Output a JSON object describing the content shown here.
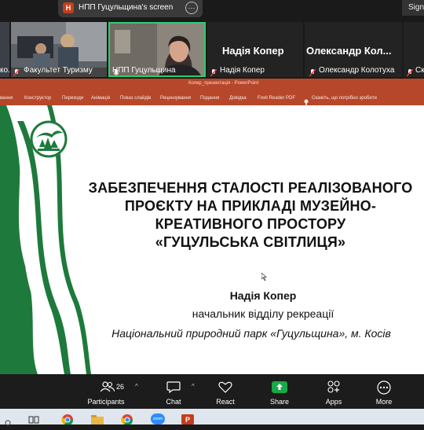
{
  "share_bar": {
    "app_letter": "H",
    "title": "НПП Гуцульщина's screen",
    "sign_label": "Sign"
  },
  "participants": [
    {
      "name": "Факультет Туризму",
      "prefix": "ко..."
    },
    {
      "name": "НПП Гуцульщина"
    },
    {
      "name": "Надія Копер",
      "display": "Надія Копер"
    },
    {
      "name": "Олександр Колотуха",
      "display": "Олександр Кол..."
    },
    {
      "name": "Ск"
    }
  ],
  "powerpoint": {
    "title": "Копер_презентація  -  PowerPoint",
    "ribbon": [
      "вання",
      "Конструктор",
      "Переходи",
      "Анімація",
      "Показ слайдів",
      "Рецензування",
      "Подання",
      "Довідка",
      "Foxit Reader PDF",
      "Скажіть, що потрібно зробити"
    ]
  },
  "slide": {
    "title_lines": [
      "ЗАБЕЗПЕЧЕННЯ СТАЛОСТІ РЕАЛІЗОВАНОГО",
      "ПРОЄКТУ НА ПРИКЛАДІ МУЗЕЙНО-",
      "КРЕАТИВНОГО ПРОСТОРУ",
      "«ГУЦУЛЬСЬКА СВІТЛИЦЯ»"
    ],
    "author": "Надія Копер",
    "position": "начальник відділу рекреації",
    "organization": "Національний природний парк «Гуцульщина», м. Косів"
  },
  "toolbar": {
    "participants_count": "26",
    "participants_label": "Participants",
    "chat_label": "Chat",
    "react_label": "React",
    "share_label": "Share",
    "apps_label": "Apps",
    "more_label": "More"
  },
  "taskbar": {
    "zoom_label": "zoom"
  },
  "colors": {
    "ppt_red": "#b7472a",
    "park_green": "#1e7a3c",
    "share_green": "#19a84a",
    "active_border": "#2ecc71"
  }
}
